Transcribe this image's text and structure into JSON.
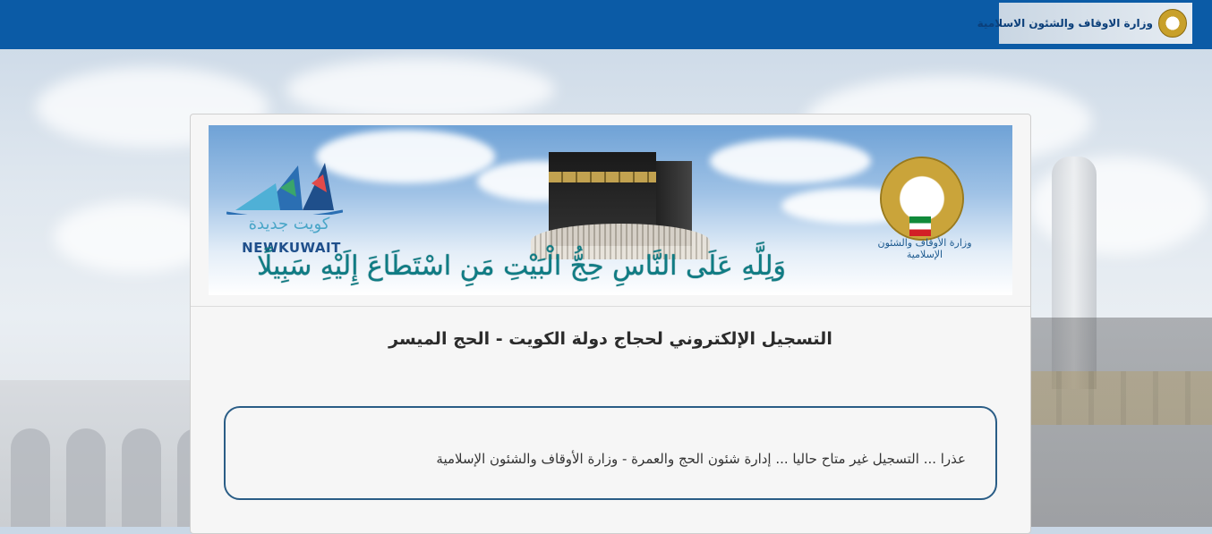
{
  "header": {
    "brand_text": "وزارة الاوقاف والشئون الاسلامية",
    "brand_icon": "ministry-emblem-icon",
    "bar_color": "#0b5ba6"
  },
  "banner": {
    "calligraphy": "وَلِلَّهِ عَلَى النَّاسِ حِجُّ الْبَيْتِ مَنِ اسْتَطَاعَ إِلَيْهِ سَبِيلًا",
    "new_kuwait_ar": "كويت جديدة",
    "new_kuwait_en": "NEWKUWAIT",
    "ministry_seal_text": "وزارة الأوقاف والشئون الإسلامية"
  },
  "page": {
    "title": "التسجيل الإلكتروني لحجاج دولة الكويت - الحج الميسر",
    "notice": "عذرا ... التسجيل غير متاح حاليا ... إدارة شئون الحج والعمرة - وزارة الأوقاف والشئون الإسلامية"
  }
}
